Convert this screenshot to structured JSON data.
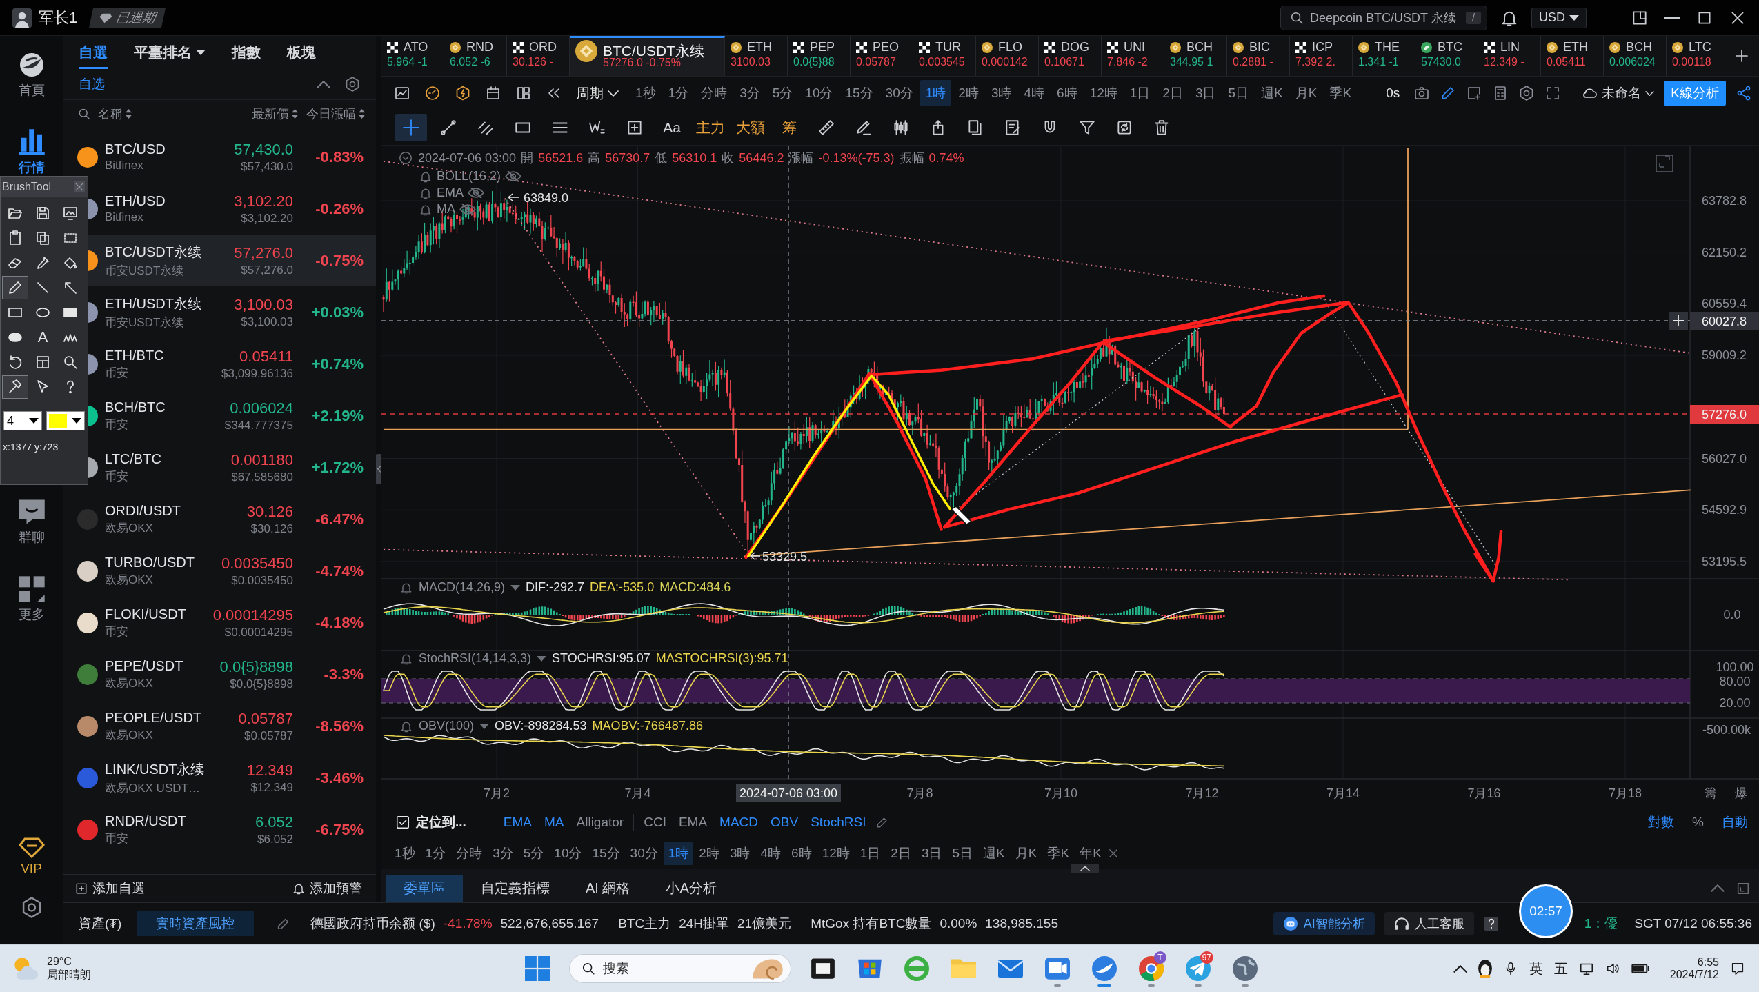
{
  "title_bar": {
    "user": "军长1",
    "badge": "已過期",
    "search": {
      "value": "Deepcoin BTC/USDT 永续",
      "shortcut": "/"
    },
    "currency": "USD"
  },
  "nav": [
    {
      "label": "首頁",
      "kind": "logo",
      "selected": false
    },
    {
      "label": "行情",
      "kind": "market",
      "selected": true
    },
    {
      "label": "群聊",
      "kind": "chat",
      "selected": false
    },
    {
      "label": "更多",
      "kind": "more",
      "selected": false
    },
    {
      "label": "VIP",
      "kind": "vip",
      "selected": false
    },
    {
      "kind": "settings",
      "selected": false
    }
  ],
  "watchlist": {
    "tabs": [
      {
        "label": "自選",
        "selected": true,
        "dropdown": false
      },
      {
        "label": "平臺排名",
        "selected": false,
        "dropdown": true
      },
      {
        "label": "指數",
        "selected": false,
        "dropdown": false
      },
      {
        "label": "板塊",
        "selected": false,
        "dropdown": false
      }
    ],
    "group": "自选",
    "columns": [
      {
        "label": "名稱"
      },
      {
        "label": "最新價"
      },
      {
        "label": "今日漲幅"
      }
    ],
    "rows": [
      {
        "symbol": "BTC/USD",
        "exchange": "Bitfinex",
        "price": "57,430.0",
        "price_up": true,
        "usd": "$57,430.0",
        "change": "-0.83%",
        "change_up": false,
        "color": "#f7931a",
        "selected": false
      },
      {
        "symbol": "ETH/USD",
        "exchange": "Bitfinex",
        "price": "3,102.20",
        "price_up": false,
        "usd": "$3,102.20",
        "change": "-0.26%",
        "change_up": false,
        "color": "#8c93ad",
        "selected": false
      },
      {
        "symbol": "BTC/USDT永续",
        "exchange": "币安USDT永续",
        "price": "57,276.0",
        "price_up": false,
        "usd": "$57,276.0",
        "change": "-0.75%",
        "change_up": false,
        "color": "#f7931a",
        "selected": true
      },
      {
        "symbol": "ETH/USDT永续",
        "exchange": "币安USDT永续",
        "price": "3,100.03",
        "price_up": false,
        "usd": "$3,100.03",
        "change": "+0.03%",
        "change_up": true,
        "color": "#8c93ad",
        "selected": false
      },
      {
        "symbol": "ETH/BTC",
        "exchange": "币安",
        "price": "0.05411",
        "price_up": false,
        "usd": "$3,099.96136",
        "change": "+0.74%",
        "change_up": true,
        "color": "#8c93ad",
        "selected": false
      },
      {
        "symbol": "BCH/BTC",
        "exchange": "币安",
        "price": "0.006024",
        "price_up": true,
        "usd": "$344.777375",
        "change": "+2.19%",
        "change_up": true,
        "color": "#0ac18e",
        "selected": false
      },
      {
        "symbol": "LTC/BTC",
        "exchange": "币安",
        "price": "0.001180",
        "price_up": false,
        "usd": "$67.585680",
        "change": "+1.72%",
        "change_up": true,
        "color": "#a6a9ad",
        "selected": false
      },
      {
        "symbol": "ORDI/USDT",
        "exchange": "欧易OKX",
        "price": "30.126",
        "price_up": false,
        "usd": "$30.126",
        "change": "-6.47%",
        "change_up": false,
        "color": "#2b2b2b",
        "selected": false
      },
      {
        "symbol": "TURBO/USDT",
        "exchange": "欧易OKX",
        "price": "0.0035450",
        "price_up": false,
        "usd": "$0.0035450",
        "change": "-4.74%",
        "change_up": false,
        "color": "#d9cfc4",
        "selected": false
      },
      {
        "symbol": "FLOKI/USDT",
        "exchange": "币安",
        "price": "0.00014295",
        "price_up": false,
        "usd": "$0.00014295",
        "change": "-4.18%",
        "change_up": false,
        "color": "#e9dccb",
        "selected": false
      },
      {
        "symbol": "PEPE/USDT",
        "exchange": "欧易OKX",
        "price": "0.0{5}8898",
        "price_up": true,
        "usd": "$0.0{5}8898",
        "change": "-3.3%",
        "change_up": false,
        "color": "#3f7d3a",
        "selected": false
      },
      {
        "symbol": "PEOPLE/USDT",
        "exchange": "欧易OKX",
        "price": "0.05787",
        "price_up": false,
        "usd": "$0.05787",
        "change": "-8.56%",
        "change_up": false,
        "color": "#b98a6a",
        "selected": false
      },
      {
        "symbol": "LINK/USDT永续",
        "exchange": "欧易OKX USDT…",
        "price": "12.349",
        "price_up": false,
        "usd": "$12.349",
        "change": "-3.46%",
        "change_up": false,
        "color": "#2a5ada",
        "selected": false
      },
      {
        "symbol": "RNDR/USDT",
        "exchange": "币安",
        "price": "6.052",
        "price_up": true,
        "usd": "$6.052",
        "change": "-6.75%",
        "change_up": false,
        "color": "#e0282c",
        "selected": false
      }
    ],
    "footer": {
      "add": "添加自選",
      "alert": "添加預警"
    }
  },
  "brush_tool": {
    "title": "BrushTool",
    "tools": [
      {
        "kind": "folder",
        "selected": false
      },
      {
        "kind": "save",
        "selected": false
      },
      {
        "kind": "monitor",
        "selected": false
      },
      {
        "kind": "paste",
        "selected": false
      },
      {
        "kind": "copy",
        "selected": false
      },
      {
        "kind": "select",
        "selected": false
      },
      {
        "kind": "eraser",
        "selected": false
      },
      {
        "kind": "dropper",
        "selected": false
      },
      {
        "kind": "bucket",
        "selected": false
      },
      {
        "kind": "pencil",
        "selected": true
      },
      {
        "kind": "line",
        "selected": false
      },
      {
        "kind": "arrow",
        "selected": false
      },
      {
        "kind": "rect",
        "selected": false
      },
      {
        "kind": "ellipse",
        "selected": false
      },
      {
        "kind": "rectfill",
        "selected": false
      },
      {
        "kind": "ellipsefill",
        "selected": false
      },
      {
        "kind": "text",
        "label": "A",
        "selected": false
      },
      {
        "kind": "scribble",
        "selected": false
      },
      {
        "kind": "undo",
        "selected": false
      },
      {
        "kind": "frame",
        "selected": false
      },
      {
        "kind": "zoom",
        "selected": false
      },
      {
        "kind": "hammer",
        "selected": true
      },
      {
        "kind": "pointer",
        "selected": false
      },
      {
        "kind": "help",
        "selected": false
      }
    ],
    "size": "4",
    "color": "#ffff00",
    "coords": "x:1377 y:723"
  },
  "tickers": [
    {
      "name": "ATO",
      "price": "5.964 -1",
      "up": true,
      "kind": "checker",
      "selected": false
    },
    {
      "name": "RND",
      "price": "6.052 -6",
      "up": true,
      "kind": "coin",
      "selected": false
    },
    {
      "name": "ORD",
      "price": "30.126 -",
      "up": false,
      "kind": "checker",
      "selected": false
    },
    {
      "name": "BTC/USDT永续",
      "price": "57276.0 -0.75%",
      "up": false,
      "kind": "coin",
      "selected": true
    },
    {
      "name": "ETH",
      "price": "3100.03",
      "up": false,
      "kind": "coin",
      "selected": false
    },
    {
      "name": "PEP",
      "price": "0.0{5}88",
      "up": true,
      "kind": "checker",
      "selected": false
    },
    {
      "name": "PEO",
      "price": "0.05787",
      "up": false,
      "kind": "checker",
      "selected": false
    },
    {
      "name": "TUR",
      "price": "0.003545",
      "up": false,
      "kind": "checker",
      "selected": false
    },
    {
      "name": "FLO",
      "price": "0.000142",
      "up": false,
      "kind": "coin",
      "selected": false
    },
    {
      "name": "DOG",
      "price": "0.10671",
      "up": false,
      "kind": "checker",
      "selected": false
    },
    {
      "name": "UNI",
      "price": "7.846 -2",
      "up": false,
      "kind": "checker",
      "selected": false
    },
    {
      "name": "BCH",
      "price": "344.95 1",
      "up": true,
      "kind": "coin",
      "selected": false
    },
    {
      "name": "BIC",
      "price": "0.2881 -",
      "up": false,
      "kind": "coin",
      "selected": false
    },
    {
      "name": "ICP",
      "price": "7.392 2.",
      "up": false,
      "kind": "checker",
      "selected": false
    },
    {
      "name": "THE",
      "price": "1.341 -1",
      "up": true,
      "kind": "coin",
      "selected": false
    },
    {
      "name": "BTC",
      "price": "57430.0",
      "up": true,
      "kind": "leaf",
      "selected": false
    },
    {
      "name": "LIN",
      "price": "12.349 -",
      "up": false,
      "kind": "checker",
      "selected": false
    },
    {
      "name": "ETH",
      "price": "0.05411",
      "up": false,
      "kind": "coin",
      "selected": false
    },
    {
      "name": "BCH",
      "price": "0.006024",
      "up": true,
      "kind": "coin",
      "selected": false
    },
    {
      "name": "LTC",
      "price": "0.00118",
      "up": false,
      "kind": "coin",
      "selected": false
    }
  ],
  "toolbar": {
    "left": [
      {
        "kind": "chart"
      },
      {
        "kind": "gauge"
      },
      {
        "kind": "bolt"
      },
      {
        "kind": "calendar"
      },
      {
        "kind": "layout"
      },
      {
        "kind": "rewind"
      }
    ],
    "period": "周期",
    "timeframes": [
      {
        "label": "1秒",
        "selected": false
      },
      {
        "label": "1分",
        "selected": false
      },
      {
        "label": "分時",
        "selected": false
      },
      {
        "label": "3分",
        "selected": false
      },
      {
        "label": "5分",
        "selected": false
      },
      {
        "label": "10分",
        "selected": false
      },
      {
        "label": "15分",
        "selected": false
      },
      {
        "label": "30分",
        "selected": false
      },
      {
        "label": "1時",
        "selected": true
      },
      {
        "label": "2時",
        "selected": false
      },
      {
        "label": "3時",
        "selected": false
      },
      {
        "label": "4時",
        "selected": false
      },
      {
        "label": "6時",
        "selected": false
      },
      {
        "label": "12時",
        "selected": false
      },
      {
        "label": "1日",
        "selected": false
      },
      {
        "label": "2日",
        "selected": false
      },
      {
        "label": "3日",
        "selected": false
      },
      {
        "label": "5日",
        "selected": false
      },
      {
        "label": "週K",
        "selected": false
      },
      {
        "label": "月K",
        "selected": false
      },
      {
        "label": "季K",
        "selected": false
      }
    ],
    "countdown": "0s",
    "right": [
      {
        "kind": "camera",
        "active": false
      },
      {
        "kind": "pencil",
        "active": true
      },
      {
        "kind": "addframe",
        "active": false
      },
      {
        "kind": "calculator",
        "active": false
      },
      {
        "kind": "gear",
        "active": false
      },
      {
        "kind": "fullscreen",
        "active": false
      }
    ],
    "layout_name": "未命名",
    "analysis": "K線分析"
  },
  "drawing_tools": [
    {
      "kind": "crosshair",
      "selected": true
    },
    {
      "kind": "trendline",
      "selected": false
    },
    {
      "kind": "fork",
      "selected": false
    },
    {
      "kind": "rect",
      "selected": false
    },
    {
      "kind": "lines",
      "selected": false
    },
    {
      "kind": "wave",
      "selected": false
    },
    {
      "kind": "plusbox",
      "selected": false
    },
    {
      "kind": "text",
      "label": "Aa",
      "color": "#d6d8dc",
      "selected": false
    },
    {
      "kind": "text",
      "label": "主力",
      "color": "#e9a23b",
      "selected": false
    },
    {
      "kind": "text",
      "label": "大額",
      "color": "#e9a23b",
      "selected": false
    },
    {
      "kind": "text",
      "label": "筹",
      "color": "#e9a23b",
      "selected": false
    },
    {
      "kind": "ruler",
      "selected": false
    },
    {
      "kind": "penline",
      "selected": false
    },
    {
      "kind": "candles",
      "selected": false
    },
    {
      "kind": "clip",
      "selected": false
    },
    {
      "kind": "bookmark",
      "selected": false
    },
    {
      "kind": "note",
      "selected": false
    },
    {
      "kind": "magnet",
      "selected": false
    },
    {
      "kind": "filter",
      "selected": false
    },
    {
      "kind": "refresh",
      "selected": false
    },
    {
      "kind": "trash",
      "selected": false
    }
  ],
  "chart": {
    "ohlc": {
      "date": "2024-07-06 03:00",
      "falling": true,
      "fields": [
        {
          "label": "開",
          "value": "56521.6"
        },
        {
          "label": "高",
          "value": "56730.7"
        },
        {
          "label": "低",
          "value": "56310.1"
        },
        {
          "label": "收",
          "value": "56446.2"
        },
        {
          "label": "漲幅",
          "value": "-0.13%(-75.3)"
        },
        {
          "label": "振幅",
          "value": "0.74%"
        }
      ]
    },
    "overlays": [
      {
        "name": "BOLL(16,2)",
        "visible": false
      },
      {
        "name": "EMA",
        "visible": false
      },
      {
        "name": "MA",
        "visible": false
      }
    ],
    "peak_label": "63849.0",
    "low_label": "53329.5",
    "price_axis": [
      "63782.8",
      "62150.2",
      "60559.4",
      "59009.2",
      "56027.0",
      "54592.9",
      "53195.5"
    ],
    "crosshair": {
      "price": "60027.8",
      "time": "2024-07-06 03:00"
    },
    "last_price": "57276.0",
    "time_axis": [
      "7月2",
      "7月4",
      "7月8",
      "7月10",
      "7月12",
      "7月14",
      "7月16",
      "7月18"
    ],
    "corner": [
      "籌",
      "爆"
    ],
    "macd": {
      "name": "MACD(14,26,9)",
      "values": [
        {
          "text": "DIF:-292.7",
          "color": "#e6e6e6"
        },
        {
          "text": "DEA:-535.0",
          "color": "#e8d44d"
        },
        {
          "text": "MACD:484.6",
          "color": "#d9d35a"
        }
      ],
      "axis": [
        "0.0"
      ]
    },
    "stochrsi": {
      "name": "StochRSI(14,14,3,3)",
      "values": [
        {
          "text": "STOCHRSI:95.07",
          "color": "#e6e6e6"
        },
        {
          "text": "MASTOCHRSI(3):95.71",
          "color": "#e8d44d"
        }
      ],
      "axis": [
        "100.00",
        "80.00",
        "20.00"
      ]
    },
    "obv": {
      "name": "OBV(100)",
      "values": [
        {
          "text": "OBV:-898284.53",
          "color": "#e6e6e6"
        },
        {
          "text": "MAOBV:-766487.86",
          "color": "#e8d44d"
        }
      ],
      "axis": [
        "-500.00k"
      ]
    }
  },
  "indicator_bar": {
    "locate": "定位到...",
    "main": [
      {
        "label": "EMA",
        "selected": true
      },
      {
        "label": "MA",
        "selected": true
      },
      {
        "label": "Alligator",
        "selected": false
      }
    ],
    "sub": [
      {
        "label": "CCI",
        "selected": false
      },
      {
        "label": "EMA",
        "selected": false
      },
      {
        "label": "MACD",
        "selected": true
      },
      {
        "label": "OBV",
        "selected": true
      },
      {
        "label": "StochRSI",
        "selected": true
      }
    ],
    "scale": [
      {
        "label": "對數",
        "selected": true
      },
      {
        "label": "%",
        "selected": false
      },
      {
        "label": "自動",
        "selected": true
      }
    ]
  },
  "timeframes": [
    {
      "label": "1秒",
      "selected": false
    },
    {
      "label": "1分",
      "selected": false
    },
    {
      "label": "分時",
      "selected": false
    },
    {
      "label": "3分",
      "selected": false
    },
    {
      "label": "5分",
      "selected": false
    },
    {
      "label": "10分",
      "selected": false
    },
    {
      "label": "15分",
      "selected": false
    },
    {
      "label": "30分",
      "selected": false
    },
    {
      "label": "1時",
      "selected": true
    },
    {
      "label": "2時",
      "selected": false
    },
    {
      "label": "3時",
      "selected": false
    },
    {
      "label": "4時",
      "selected": false
    },
    {
      "label": "6時",
      "selected": false
    },
    {
      "label": "12時",
      "selected": false
    },
    {
      "label": "1日",
      "selected": false
    },
    {
      "label": "2日",
      "selected": false
    },
    {
      "label": "3日",
      "selected": false
    },
    {
      "label": "5日",
      "selected": false
    },
    {
      "label": "週K",
      "selected": false
    },
    {
      "label": "月K",
      "selected": false
    },
    {
      "label": "季K",
      "selected": false
    },
    {
      "label": "年K",
      "selected": false
    }
  ],
  "bottom_tabs": [
    {
      "label": "委單區",
      "selected": true
    },
    {
      "label": "自定義指標",
      "selected": false
    },
    {
      "label": "AI 網格",
      "selected": false
    },
    {
      "label": "小A分析",
      "selected": false
    }
  ],
  "status_bar": {
    "asset": "資產(₮)",
    "risk_button": "實時資產風控",
    "metrics": [
      {
        "text": "德國政府持币余额 ($)",
        "kind": "label"
      },
      {
        "text": "-41.78%",
        "kind": "down"
      },
      {
        "text": "522,676,655.167",
        "kind": "value"
      },
      {
        "text": "BTC主力",
        "kind": "label"
      },
      {
        "text": "24H掛單",
        "kind": "value"
      },
      {
        "text": "21億美元",
        "kind": "value"
      },
      {
        "text": "MtGox 持有BTC數量",
        "kind": "label"
      },
      {
        "text": "0.00%",
        "kind": "value"
      },
      {
        "text": "138,985.155",
        "kind": "value"
      }
    ],
    "ai_button": "AI智能分析",
    "service_button": "人工客服",
    "latency": "1：優",
    "clock": "SGT 07/12 06:55:36"
  },
  "recorder": {
    "time": "02:57"
  },
  "taskbar": {
    "weather": {
      "temp": "29°C",
      "desc": "局部晴朗"
    },
    "search": "搜索",
    "apps": [
      {
        "kind": "start",
        "running": false,
        "selected": false
      },
      {
        "kind": "taskview",
        "running": false,
        "selected": false
      },
      {
        "kind": "store",
        "running": false,
        "selected": false
      },
      {
        "kind": "browser",
        "running": false,
        "selected": false
      },
      {
        "kind": "folder",
        "running": false,
        "selected": false
      },
      {
        "kind": "mail",
        "running": false,
        "selected": false
      },
      {
        "kind": "meeting",
        "running": true,
        "selected": false
      },
      {
        "kind": "app",
        "running": true,
        "selected": true
      },
      {
        "kind": "chrome",
        "running": true,
        "selected": false,
        "badge": "T"
      },
      {
        "kind": "telegram",
        "running": true,
        "selected": false,
        "badge": "97"
      },
      {
        "kind": "globe",
        "running": true,
        "selected": false
      }
    ],
    "ime": [
      "英",
      "五"
    ],
    "time": "6:55",
    "date": "2024/7/12"
  }
}
